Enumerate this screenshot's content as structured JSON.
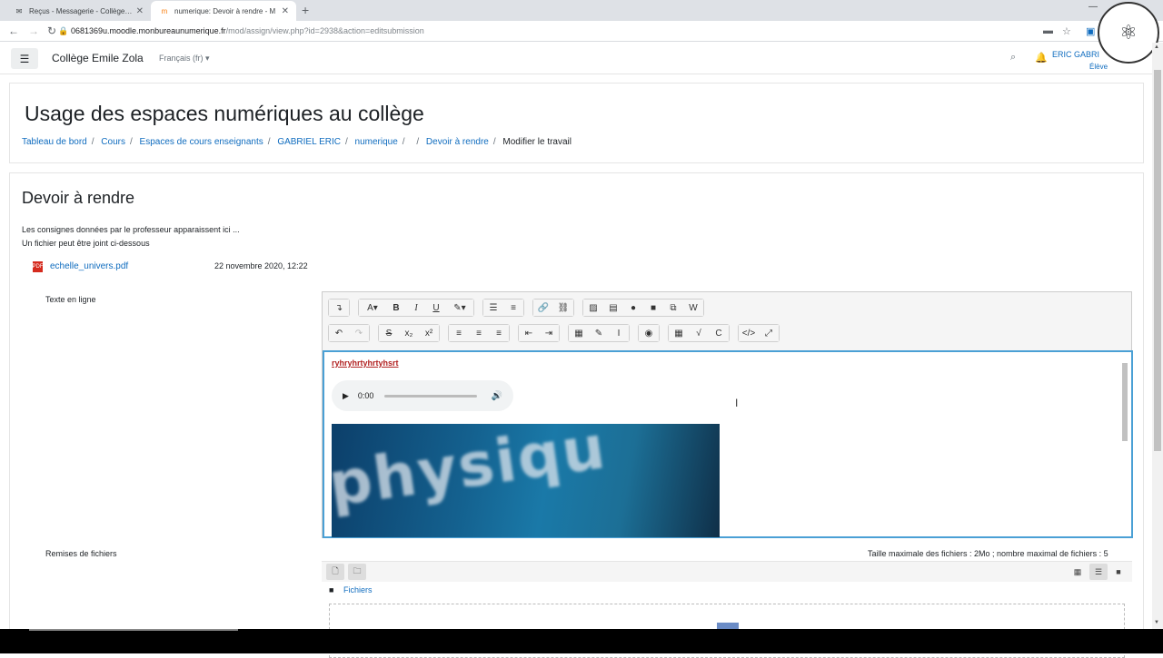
{
  "browser": {
    "tabs": [
      {
        "title": "Reçus - Messagerie - Collège Em",
        "icon": "mail-icon"
      },
      {
        "title": "numerique: Devoir à rendre - M",
        "icon": "moodle-icon"
      }
    ],
    "url_host": "0681369u.moodle.monbureaunumerique.fr",
    "url_path": "/mod/assign/view.php?id=2938&action=editsubmission"
  },
  "navbar": {
    "site_name": "Collège Emile Zola",
    "language": "Français (fr)",
    "user_name": "ERIC GABRI",
    "user_role": "Élève"
  },
  "header": {
    "title": "Usage des espaces numériques au collège",
    "breadcrumbs": [
      "Tableau de bord",
      "Cours",
      "Espaces de cours enseignants",
      "GABRIEL ERIC",
      "numerique",
      "",
      "Devoir à rendre"
    ],
    "current": "Modifier le travail"
  },
  "assignment": {
    "title": "Devoir à rendre",
    "instructions_1": "Les consignes données par le professeur apparaissent ici ...",
    "instructions_2": "Un fichier peut être joint ci-dessous",
    "file_name": "echelle_univers.pdf",
    "file_date": "22 novembre 2020, 12:22"
  },
  "editor": {
    "label": "Texte en ligne",
    "content_text": "ryhryhrtyhrtyhsrt",
    "audio_time": "0:00",
    "image_text": "physiqu"
  },
  "files": {
    "label": "Remises de fichiers",
    "limits": "Taille maximale des fichiers : 2Mo ; nombre maximal de fichiers : 5",
    "folder_label": "Fichiers"
  },
  "colors": {
    "link": "#0f6cbf",
    "editor_focus": "#4aa0d5"
  }
}
